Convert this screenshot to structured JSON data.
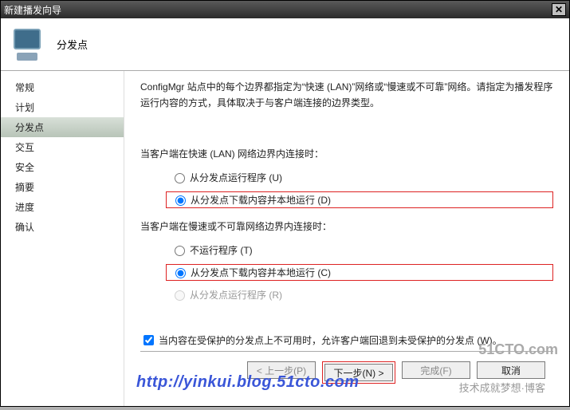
{
  "window": {
    "title": "新建播发向导"
  },
  "header": {
    "page": "分发点"
  },
  "sidebar": {
    "items": [
      "常规",
      "计划",
      "分发点",
      "交互",
      "安全",
      "摘要",
      "进度",
      "确认"
    ]
  },
  "content": {
    "description": "ConfigMgr 站点中的每个边界都指定为“快速 (LAN)”网络或“慢速或不可靠”网络。请指定为播发程序运行内容的方式，具体取决于与客户端连接的边界类型。",
    "fast": {
      "label": "当客户端在快速 (LAN) 网络边界内连接时：",
      "options": [
        "从分发点运行程序 (U)",
        "从分发点下载内容并本地运行 (D)"
      ]
    },
    "slow": {
      "label": "当客户端在慢速或不可靠网络边界内连接时：",
      "options": [
        "不运行程序 (T)",
        "从分发点下载内容并本地运行 (C)",
        "从分发点运行程序 (R)"
      ]
    },
    "fallback": "当内容在受保护的分发点上不可用时，允许客户端回退到未受保护的分发点 (W)。"
  },
  "buttons": {
    "back": "< 上一步(P)",
    "next": "下一步(N) >",
    "finish": "完成(F)",
    "cancel": "取消"
  },
  "watermark": {
    "url": "http://yinkui.blog.51cto.com",
    "logo": "51CTO.com",
    "sub": "技术成就梦想·博客"
  }
}
